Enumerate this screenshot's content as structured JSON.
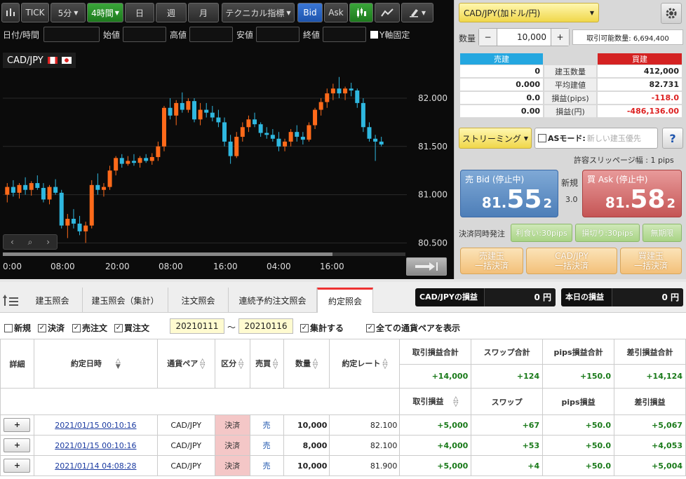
{
  "chart": {
    "toolbar": {
      "tick": "TICK",
      "m5": "5分",
      "h4": "4時間",
      "day": "日",
      "week": "週",
      "month": "月",
      "technical": "テクニカル指標",
      "bid": "Bid",
      "ask": "Ask"
    },
    "filters": {
      "datetime": "日付/時間",
      "open": "始値",
      "high": "高値",
      "low": "安値",
      "close": "終値",
      "yfix": "Y軸固定"
    },
    "symbol": "CAD/JPY",
    "colors": {
      "up": "#ff6a1a",
      "down": "#2fb8e0"
    }
  },
  "chart_data": {
    "type": "candlestick",
    "y_ticks": [
      "82.000",
      "81.500",
      "81.000",
      "80.500"
    ],
    "x_ticks": [
      "0:00",
      "08:00",
      "20:00",
      "08:00",
      "16:00",
      "04:00",
      "16:00"
    ],
    "ylim": [
      80.43,
      82.32
    ],
    "candles": [
      [
        81.0,
        81.12,
        80.92,
        81.08
      ],
      [
        81.08,
        81.15,
        80.98,
        81.02
      ],
      [
        81.02,
        81.12,
        80.96,
        81.1
      ],
      [
        81.1,
        81.18,
        81.0,
        81.05
      ],
      [
        81.05,
        81.14,
        80.99,
        81.12
      ],
      [
        81.12,
        81.2,
        81.05,
        81.07
      ],
      [
        81.07,
        81.12,
        80.92,
        80.95
      ],
      [
        80.95,
        81.1,
        80.9,
        81.08
      ],
      [
        81.08,
        81.16,
        81.0,
        81.02
      ],
      [
        81.02,
        81.05,
        80.65,
        80.68
      ],
      [
        80.68,
        80.8,
        80.55,
        80.75
      ],
      [
        80.75,
        80.85,
        80.65,
        80.7
      ],
      [
        80.7,
        80.78,
        80.58,
        80.62
      ],
      [
        80.62,
        80.72,
        80.5,
        80.68
      ],
      [
        80.68,
        81.15,
        80.65,
        81.1
      ],
      [
        81.1,
        81.22,
        81.0,
        81.05
      ],
      [
        81.05,
        81.12,
        80.98,
        81.08
      ],
      [
        81.08,
        81.3,
        81.05,
        81.25
      ],
      [
        81.25,
        81.4,
        81.2,
        81.38
      ],
      [
        81.38,
        81.42,
        81.28,
        81.32
      ],
      [
        81.32,
        81.4,
        81.3,
        81.35
      ],
      [
        81.35,
        81.42,
        81.3,
        81.33
      ],
      [
        81.33,
        81.4,
        81.28,
        81.38
      ],
      [
        81.38,
        81.42,
        81.33,
        81.35
      ],
      [
        81.35,
        81.43,
        81.31,
        81.39
      ],
      [
        81.39,
        81.55,
        81.35,
        81.5
      ],
      [
        81.5,
        81.92,
        81.45,
        81.9
      ],
      [
        81.9,
        82.0,
        81.78,
        81.82
      ],
      [
        81.82,
        81.98,
        81.72,
        81.95
      ],
      [
        81.95,
        82.06,
        81.85,
        81.88
      ],
      [
        81.88,
        82.0,
        81.85,
        81.97
      ],
      [
        81.97,
        82.0,
        81.75,
        81.78
      ],
      [
        81.78,
        81.95,
        81.72,
        81.88
      ],
      [
        81.88,
        81.95,
        81.8,
        81.85
      ],
      [
        81.85,
        81.92,
        81.76,
        81.8
      ],
      [
        81.8,
        81.88,
        81.7,
        81.75
      ],
      [
        81.75,
        81.8,
        81.5,
        81.55
      ],
      [
        81.55,
        81.62,
        81.32,
        81.4
      ],
      [
        81.4,
        81.65,
        81.38,
        81.6
      ],
      [
        81.6,
        81.75,
        81.55,
        81.7
      ],
      [
        81.7,
        81.82,
        81.65,
        81.78
      ],
      [
        81.78,
        81.85,
        81.7,
        81.73
      ],
      [
        81.73,
        81.75,
        81.6,
        81.64
      ],
      [
        81.64,
        81.7,
        81.58,
        81.62
      ],
      [
        81.62,
        81.68,
        81.55,
        81.58
      ],
      [
        81.58,
        81.65,
        81.45,
        81.5
      ],
      [
        81.5,
        81.58,
        81.45,
        81.55
      ],
      [
        81.55,
        81.68,
        81.5,
        81.65
      ],
      [
        81.65,
        81.72,
        81.55,
        81.6
      ],
      [
        81.6,
        81.65,
        81.52,
        81.57
      ],
      [
        81.57,
        81.75,
        81.55,
        81.72
      ],
      [
        81.72,
        81.9,
        81.68,
        81.88
      ],
      [
        81.88,
        82.0,
        81.82,
        81.96
      ],
      [
        81.96,
        82.1,
        81.9,
        82.05
      ],
      [
        82.05,
        82.15,
        81.98,
        82.1
      ],
      [
        82.1,
        82.22,
        82.0,
        82.05
      ],
      [
        82.05,
        82.12,
        81.98,
        82.1
      ],
      [
        82.1,
        82.16,
        82.02,
        82.08
      ],
      [
        82.08,
        82.1,
        81.9,
        81.95
      ],
      [
        81.95,
        82.0,
        81.65,
        81.7
      ],
      [
        81.7,
        81.75,
        81.55,
        81.58
      ],
      [
        81.58,
        81.62,
        81.35,
        81.55
      ],
      [
        81.55,
        81.6,
        81.5,
        81.52
      ]
    ]
  },
  "order": {
    "pair": "CAD/JPY(加ドル/円)",
    "qty_label": "数量",
    "minus": "−",
    "qty_value": "10,000",
    "plus": "+",
    "available": "取引可能数量: 6,694,400",
    "sell_header": "売建",
    "buy_header": "買建",
    "rows": [
      {
        "label": "建玉数量",
        "sell": "0",
        "buy": "412,000",
        "buy_neg": false
      },
      {
        "label": "平均建値",
        "sell": "0.000",
        "buy": "82.731",
        "buy_neg": false
      },
      {
        "label": "損益(pips)",
        "sell": "0.0",
        "buy": "-118.0",
        "buy_neg": true
      },
      {
        "label": "損益(円)",
        "sell": "0.00",
        "buy": "-486,136.00",
        "buy_neg": true
      }
    ],
    "streaming": "ストリーミング",
    "as_mode": "ASモード:",
    "as_mode_value": "新しい建玉優先",
    "help": "?",
    "slippage": "許容スリッページ幅 : 1 pips",
    "bid_label": "売 Bid (停止中)",
    "bid_main": "81.",
    "bid_big": "55",
    "bid_small": "2",
    "ask_label": "買 Ask (停止中)",
    "ask_main": "81.",
    "ask_big": "58",
    "ask_small": "2",
    "new_label": "新規",
    "spread": "3.0",
    "settle_label": "決済同時発注",
    "take_profit": "利食い:30pips",
    "stop_loss": "損切り:30pips",
    "no_limit": "無期限",
    "sell_close_1": "売建玉",
    "sell_close_2": "一括決済",
    "pair_close_1": "CAD/JPY",
    "pair_close_2": "一括決済",
    "buy_close_1": "買建玉",
    "buy_close_2": "一括決済"
  },
  "bottom": {
    "tabs": [
      "建玉照会",
      "建玉照会（集計）",
      "注文照会",
      "連続予約注文照会",
      "約定照会"
    ],
    "pair_pl_label": "CAD/JPYの損益",
    "pair_pl_value": "0 円",
    "today_pl_label": "本日の損益",
    "today_pl_value": "0 円",
    "filters": {
      "new": "新規",
      "settle": "決済",
      "sell": "売注文",
      "buy": "買注文",
      "aggregate": "集計する",
      "all_pairs": "全ての通貨ペアを表示"
    },
    "date_from": "20210111",
    "date_sep": "〜",
    "date_to": "20210116",
    "headers": {
      "detail": "詳細",
      "datetime": "約定日時",
      "pair": "通貨ペア",
      "kind": "区分",
      "side": "売買",
      "qty": "数量",
      "rate": "約定レート",
      "total_trade": "取引損益合計",
      "total_swap": "スワップ合計",
      "total_pips": "pips損益合計",
      "total_diff": "差引損益合計",
      "trade": "取引損益",
      "swap": "スワップ",
      "pips": "pips損益",
      "diff": "差引損益"
    },
    "totals": {
      "trade": "+14,000",
      "swap": "+124",
      "pips": "+150.0",
      "diff": "+14,124"
    },
    "rows": [
      {
        "btn": "+",
        "datetime": "2021/01/15 00:10:16",
        "pair": "CAD/JPY",
        "kind": "決済",
        "side": "売",
        "qty": "10,000",
        "rate": "82.100",
        "trade": "+5,000",
        "swap": "+67",
        "pips": "+50.0",
        "diff": "+5,067"
      },
      {
        "btn": "+",
        "datetime": "2021/01/15 00:10:16",
        "pair": "CAD/JPY",
        "kind": "決済",
        "side": "売",
        "qty": "8,000",
        "rate": "82.100",
        "trade": "+4,000",
        "swap": "+53",
        "pips": "+50.0",
        "diff": "+4,053"
      },
      {
        "btn": "+",
        "datetime": "2021/01/14 04:08:28",
        "pair": "CAD/JPY",
        "kind": "決済",
        "side": "売",
        "qty": "10,000",
        "rate": "81.900",
        "trade": "+5,000",
        "swap": "+4",
        "pips": "+50.0",
        "diff": "+5,004"
      }
    ]
  }
}
